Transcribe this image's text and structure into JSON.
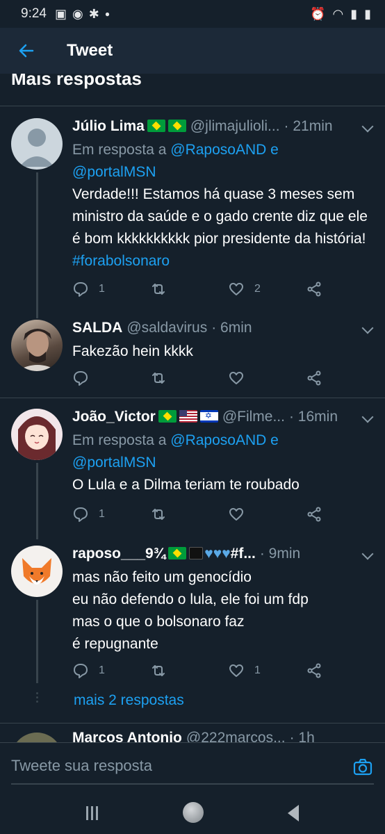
{
  "status": {
    "time": "9:24"
  },
  "appbar": {
    "title": "Tweet"
  },
  "section": {
    "title": "Mais respostas"
  },
  "tweets": [
    {
      "name": "Júlio Lima",
      "handle": "@jlimajulioli...",
      "time": "· 21min",
      "reply_prefix": "Em resposta a",
      "reply_user1": "@RaposoAND",
      "reply_and": "e",
      "reply_user2": "@portalMSN",
      "text_plain": "Verdade!!! Estamos há quase 3 meses sem ministro da saúde e o gado crente diz que ele é bom kkkkkkkkkk pior presidente da história!",
      "hashtag": "#forabolsonaro",
      "replies": "1",
      "retweets": "",
      "likes": "2"
    },
    {
      "name": "SALDA",
      "handle": "@saldavirus",
      "time": "· 6min",
      "text_plain": "Fakezão hein kkkk",
      "replies": "",
      "retweets": "",
      "likes": ""
    },
    {
      "name": "João_Victor",
      "handle": "@Filme...",
      "time": "· 16min",
      "reply_prefix": "Em resposta a",
      "reply_user1": "@RaposoAND",
      "reply_and": "e",
      "reply_user2": "@portalMSN",
      "text_plain": "O Lula e a Dilma teriam te roubado",
      "replies": "1",
      "retweets": "",
      "likes": ""
    },
    {
      "name": "raposo___9¾",
      "name_suffix": "#f...",
      "time": "· 9min",
      "text_plain": "mas não feito um genocídio\neu não defendo o lula, ele foi um fdp\nmas o que o bolsonaro faz\né repugnante",
      "replies": "1",
      "retweets": "",
      "likes": "1"
    }
  ],
  "more_replies": "mais 2 respostas",
  "partial": {
    "name": "Marcos Antonio",
    "handle": "@222marcos...",
    "time": "· 1h"
  },
  "composer": {
    "placeholder": "Tweete sua resposta"
  },
  "colors": {
    "background": "#15202b",
    "appbar": "#1c2938",
    "accent": "#1da1f2",
    "secondary_text": "#8899a6",
    "divider": "#38444d"
  },
  "icons": {
    "reply": "reply-icon",
    "retweet": "retweet-icon",
    "like": "heart-icon",
    "share": "share-icon"
  }
}
